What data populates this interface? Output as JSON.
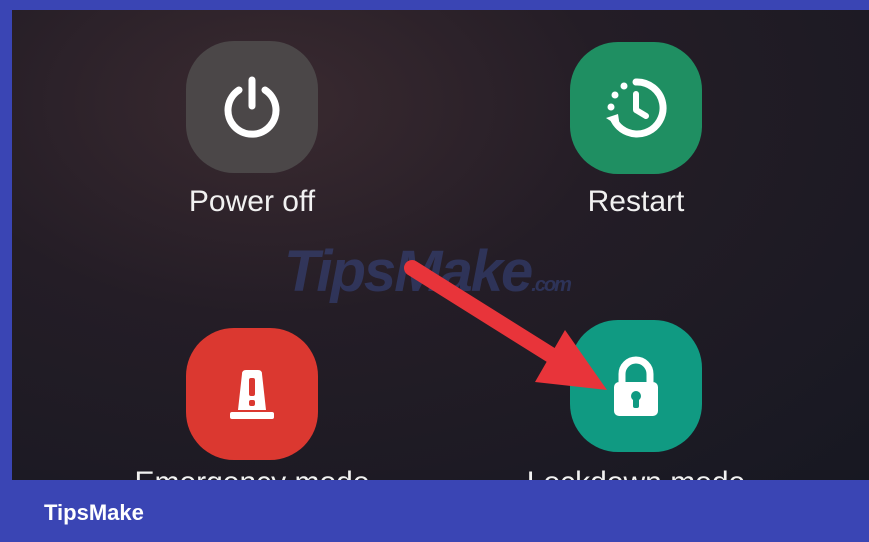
{
  "actions": {
    "power_off": {
      "label": "Power off",
      "icon": "power-icon",
      "color": "#4b4748"
    },
    "restart": {
      "label": "Restart",
      "icon": "restart-icon",
      "color": "#1f8f62"
    },
    "emergency_mode": {
      "label": "Emergency mode",
      "icon": "emergency-icon",
      "color": "#db3830"
    },
    "lockdown_mode": {
      "label": "Lockdown mode",
      "icon": "lock-icon",
      "color": "#109a82"
    }
  },
  "watermark": {
    "text": "TipsMake",
    "suffix": ".com"
  },
  "annotation": {
    "arrow_color": "#e8343a",
    "points_to": "lockdown_mode"
  },
  "footer": {
    "brand": "TipsMake",
    "color": "#3a45b4"
  }
}
